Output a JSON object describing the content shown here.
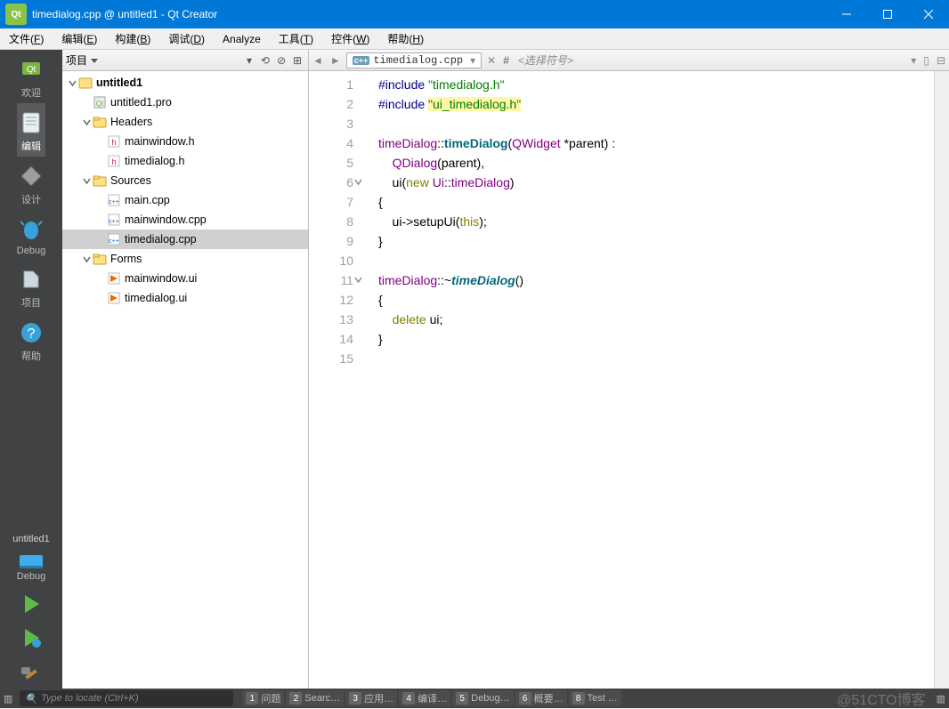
{
  "window": {
    "title": "timedialog.cpp @ untitled1 - Qt Creator"
  },
  "menus": [
    "文件(F)",
    "编辑(E)",
    "构建(B)",
    "调试(D)",
    "Analyze",
    "工具(T)",
    "控件(W)",
    "帮助(H)"
  ],
  "modes": [
    {
      "label": "欢迎"
    },
    {
      "label": "编辑"
    },
    {
      "label": "设计"
    },
    {
      "label": "Debug"
    },
    {
      "label": "项目"
    },
    {
      "label": "帮助"
    }
  ],
  "kit": {
    "name": "untitled1",
    "config": "Debug"
  },
  "sidebar": {
    "title": "项目",
    "tree": [
      {
        "d": 0,
        "exp": true,
        "icon": "proj",
        "name": "untitled1",
        "bold": true
      },
      {
        "d": 1,
        "icon": "pro",
        "name": "untitled1.pro"
      },
      {
        "d": 1,
        "exp": true,
        "icon": "folder-h",
        "name": "Headers"
      },
      {
        "d": 2,
        "icon": "h",
        "name": "mainwindow.h"
      },
      {
        "d": 2,
        "icon": "h",
        "name": "timedialog.h"
      },
      {
        "d": 1,
        "exp": true,
        "icon": "folder-c",
        "name": "Sources"
      },
      {
        "d": 2,
        "icon": "cpp",
        "name": "main.cpp"
      },
      {
        "d": 2,
        "icon": "cpp",
        "name": "mainwindow.cpp"
      },
      {
        "d": 2,
        "icon": "cpp",
        "name": "timedialog.cpp",
        "selected": true
      },
      {
        "d": 1,
        "exp": true,
        "icon": "folder-f",
        "name": "Forms"
      },
      {
        "d": 2,
        "icon": "ui",
        "name": "mainwindow.ui"
      },
      {
        "d": 2,
        "icon": "ui",
        "name": "timedialog.ui"
      }
    ]
  },
  "editor": {
    "filename": "timedialog.cpp",
    "symbol_placeholder": "<选择符号>",
    "hash": "#",
    "lines": [
      [
        {
          "c": "tok-pre",
          "t": "#include "
        },
        {
          "c": "tok-str",
          "t": "\"timedialog.h\""
        }
      ],
      [
        {
          "c": "tok-pre",
          "t": "#include "
        },
        {
          "c": "tok-str tok-hl",
          "t": "\"ui_timedialog.h\""
        }
      ],
      [],
      [
        {
          "c": "tok-type",
          "t": "timeDialog"
        },
        {
          "t": "::"
        },
        {
          "c": "tok-func",
          "t": "timeDialog"
        },
        {
          "t": "("
        },
        {
          "c": "tok-type",
          "t": "QWidget"
        },
        {
          "t": " *parent) :"
        }
      ],
      [
        {
          "t": "    "
        },
        {
          "c": "tok-type",
          "t": "QDialog"
        },
        {
          "t": "(parent),"
        }
      ],
      [
        {
          "t": "    ui("
        },
        {
          "c": "tok-kw",
          "t": "new"
        },
        {
          "t": " "
        },
        {
          "c": "tok-type",
          "t": "Ui"
        },
        {
          "t": "::"
        },
        {
          "c": "tok-type",
          "t": "timeDialog"
        },
        {
          "t": ")"
        }
      ],
      [
        {
          "t": "{"
        }
      ],
      [
        {
          "t": "    ui->setupUi("
        },
        {
          "c": "tok-this",
          "t": "this"
        },
        {
          "t": ");"
        }
      ],
      [
        {
          "t": "}"
        }
      ],
      [],
      [
        {
          "c": "tok-type",
          "t": "timeDialog"
        },
        {
          "t": "::~"
        },
        {
          "c": "tok-funcit",
          "t": "timeDialog"
        },
        {
          "t": "()"
        }
      ],
      [
        {
          "t": "{"
        }
      ],
      [
        {
          "t": "    "
        },
        {
          "c": "tok-kw",
          "t": "delete"
        },
        {
          "t": " ui;"
        }
      ],
      [
        {
          "t": "}"
        }
      ],
      []
    ],
    "fold_lines": [
      6,
      11
    ]
  },
  "locator": {
    "placeholder": "Type to locate (Ctrl+K)"
  },
  "status_tabs": [
    {
      "n": "1",
      "label": "问题"
    },
    {
      "n": "2",
      "label": "Searc…"
    },
    {
      "n": "3",
      "label": "应用…"
    },
    {
      "n": "4",
      "label": "编译…"
    },
    {
      "n": "5",
      "label": "Debug…"
    },
    {
      "n": "6",
      "label": "概要…"
    },
    {
      "n": "8",
      "label": "Test …"
    }
  ],
  "watermark": "@51CTO博客"
}
